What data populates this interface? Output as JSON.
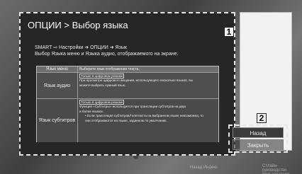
{
  "dialog": {
    "title": "ОПЦИИ > Выбор языка",
    "breadcrumb": "SMART ⇨ Настройки ➜ ОПЦИИ ➜ Язык",
    "description": "Выбор Языка меню и Языка аудио, отображаемого на экране."
  },
  "markers": {
    "one": "1",
    "two": "2"
  },
  "table": {
    "rows": [
      {
        "label": "Язык меню",
        "lines": [
          "Выберите язык отображения текста."
        ]
      },
      {
        "label": "Язык аудио",
        "tag": "Только в цифровом режиме",
        "lines": [
          "При просмотре цифрового вещания, использующего несколько языков, вы",
          "можете выбрать нужный язык."
        ]
      },
      {
        "label": "Язык субтитров",
        "tag": "Только в цифровом режиме",
        "lines": [
          "Функция «Субтитры» используется при трансляции субтитров на двух",
          "и более языках.",
          "• Если трансляция субтитров/телетекста на выбранном языке невозможна, то",
          "они отображаются на языке, заданном по умолчанию."
        ]
      }
    ]
  },
  "buttons": {
    "back": "Назад",
    "close": "Закрыть"
  },
  "bottom": {
    "hint1": "Назад  Индекс",
    "hint2": "Cтлайн-руководство пользователя"
  }
}
